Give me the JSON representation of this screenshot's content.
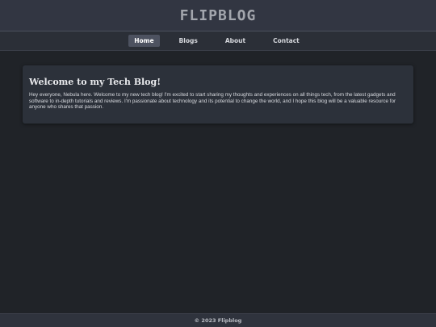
{
  "header": {
    "logo_text": "FLIPBLOG"
  },
  "nav": {
    "items": [
      {
        "label": "Home",
        "active": true
      },
      {
        "label": "Blogs",
        "active": false
      },
      {
        "label": "About",
        "active": false
      },
      {
        "label": "Contact",
        "active": false
      }
    ]
  },
  "main": {
    "title": "Welcome to my Tech Blog!",
    "body": "Hey everyone, Nebula here. Welcome to my new tech blog! I'm excited to start sharing my thoughts and experiences on all things tech, from the latest gadgets and software to in-depth tutorials and reviews. I'm passionate about technology and its potential to change the world, and I hope this blog will be a valuable resource for anyone who shares that passion."
  },
  "footer": {
    "text": "© 2023 Flipblog"
  },
  "colors": {
    "background": "#202328",
    "header": "#323642",
    "nav": "#2b2f37",
    "card": "#2c313a",
    "active_nav": "#4d5260"
  }
}
